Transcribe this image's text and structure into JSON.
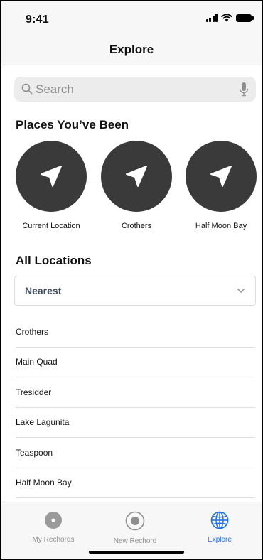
{
  "status_bar": {
    "time": "9:41"
  },
  "header": {
    "title": "Explore"
  },
  "search": {
    "placeholder": "Search"
  },
  "places_section": {
    "title": "Places You’ve Been",
    "items": [
      {
        "label": "Current Location",
        "icon": "location-arrow-icon"
      },
      {
        "label": "Crothers",
        "icon": "location-arrow-icon"
      },
      {
        "label": "Half Moon Bay",
        "icon": "location-arrow-icon"
      }
    ]
  },
  "all_locations": {
    "title": "All Locations",
    "sort_selected": "Nearest",
    "items": [
      "Crothers",
      "Main Quad",
      "Tresidder",
      "Lake Lagunita",
      "Teaspoon",
      "Half Moon Bay"
    ]
  },
  "tabbar": {
    "tabs": [
      {
        "label": "My Rechords",
        "icon": "record-disc-icon",
        "active": false
      },
      {
        "label": "New Rechord",
        "icon": "record-button-icon",
        "active": false
      },
      {
        "label": "Explore",
        "icon": "globe-icon",
        "active": true
      }
    ]
  },
  "colors": {
    "accent": "#1e6fe0",
    "circle": "#3a3a3a",
    "sort_text": "#3d4a5c"
  }
}
